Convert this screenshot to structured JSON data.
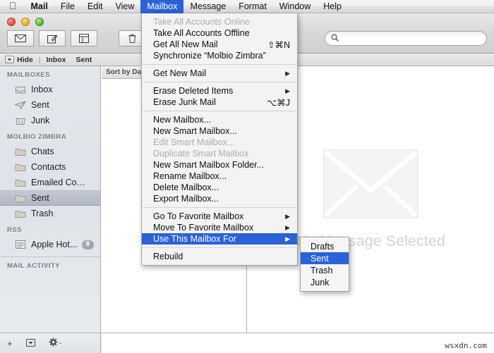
{
  "menubar": {
    "apple_icon": "apple-logo",
    "items": [
      {
        "label": "Mail",
        "bold": true,
        "active": false
      },
      {
        "label": "File",
        "bold": false,
        "active": false
      },
      {
        "label": "Edit",
        "bold": false,
        "active": false
      },
      {
        "label": "View",
        "bold": false,
        "active": false
      },
      {
        "label": "Mailbox",
        "bold": false,
        "active": true
      },
      {
        "label": "Message",
        "bold": false,
        "active": false
      },
      {
        "label": "Format",
        "bold": false,
        "active": false
      },
      {
        "label": "Window",
        "bold": false,
        "active": false
      },
      {
        "label": "Help",
        "bold": false,
        "active": false
      }
    ]
  },
  "toolbar": {
    "buttons": [
      {
        "name": "get-mail-button",
        "icon": "envelope-icon"
      },
      {
        "name": "compose-button",
        "icon": "compose-pencil-icon"
      },
      {
        "name": "reading-pane-button",
        "icon": "window-pane-icon"
      },
      {
        "name": "delete-button",
        "icon": "trash-icon"
      }
    ],
    "search_placeholder": "",
    "search_value": "",
    "search_icon": "search-icon"
  },
  "favbar": {
    "hide_label": "Hide",
    "hide_icon": "triangle-down-icon",
    "separator": "|",
    "items": [
      "Inbox",
      "Sent"
    ]
  },
  "sidebar": {
    "sections": [
      {
        "header": "MAILBOXES",
        "rows": [
          {
            "label": "Inbox",
            "icon": "inbox-tray-icon",
            "selected": false,
            "badge": ""
          },
          {
            "label": "Sent",
            "icon": "paper-plane-icon",
            "selected": false,
            "badge": ""
          },
          {
            "label": "Junk",
            "icon": "junk-bin-icon",
            "selected": false,
            "badge": ""
          }
        ]
      },
      {
        "header": "MOLBIO ZIMBRA",
        "rows": [
          {
            "label": "Chats",
            "icon": "folder-icon",
            "selected": false,
            "badge": ""
          },
          {
            "label": "Contacts",
            "icon": "folder-icon",
            "selected": false,
            "badge": ""
          },
          {
            "label": "Emailed Contacts",
            "icon": "folder-icon",
            "selected": false,
            "badge": ""
          },
          {
            "label": "Sent",
            "icon": "folder-icon",
            "selected": true,
            "badge": ""
          },
          {
            "label": "Trash",
            "icon": "folder-icon",
            "selected": false,
            "badge": ""
          }
        ]
      },
      {
        "header": "RSS",
        "rows": [
          {
            "label": "Apple Hot...",
            "icon": "rss-feed-icon",
            "selected": false,
            "badge": "8"
          }
        ]
      },
      {
        "header": "MAIL ACTIVITY",
        "rows": []
      }
    ]
  },
  "messagelist": {
    "sort_label": "Sort by Da"
  },
  "messageview": {
    "empty_icon": "large-envelope-icon",
    "empty_text": "No Message Selected"
  },
  "bottombar": {
    "add_label": "+",
    "actions_icon": "triangle-down-box-icon",
    "gear_icon": "gear-icon",
    "gear_caret": "-"
  },
  "watermark": {
    "text": "wsxdn.com"
  },
  "mailbox_menu": {
    "groups": [
      {
        "items": [
          {
            "label": "Take All Accounts Online",
            "disabled": true,
            "shortcut": "",
            "submenu": false,
            "highlighted": false
          },
          {
            "label": "Take All Accounts Offline",
            "disabled": false,
            "shortcut": "",
            "submenu": false,
            "highlighted": false
          },
          {
            "label": "Get All New Mail",
            "disabled": false,
            "shortcut": "⇧⌘N",
            "submenu": false,
            "highlighted": false
          },
          {
            "label": "Synchronize “Molbio Zimbra”",
            "disabled": false,
            "shortcut": "",
            "submenu": false,
            "highlighted": false
          }
        ]
      },
      {
        "items": [
          {
            "label": "Get New Mail",
            "disabled": false,
            "shortcut": "",
            "submenu": true,
            "highlighted": false
          }
        ]
      },
      {
        "items": [
          {
            "label": "Erase Deleted Items",
            "disabled": false,
            "shortcut": "",
            "submenu": true,
            "highlighted": false
          },
          {
            "label": "Erase Junk Mail",
            "disabled": false,
            "shortcut": "⌥⌘J",
            "submenu": false,
            "highlighted": false
          }
        ]
      },
      {
        "items": [
          {
            "label": "New Mailbox...",
            "disabled": false,
            "shortcut": "",
            "submenu": false,
            "highlighted": false
          },
          {
            "label": "New Smart Mailbox...",
            "disabled": false,
            "shortcut": "",
            "submenu": false,
            "highlighted": false
          },
          {
            "label": "Edit Smart Mailbox...",
            "disabled": true,
            "shortcut": "",
            "submenu": false,
            "highlighted": false
          },
          {
            "label": "Duplicate Smart Mailbox",
            "disabled": true,
            "shortcut": "",
            "submenu": false,
            "highlighted": false
          },
          {
            "label": "New Smart Mailbox Folder...",
            "disabled": false,
            "shortcut": "",
            "submenu": false,
            "highlighted": false
          },
          {
            "label": "Rename Mailbox...",
            "disabled": false,
            "shortcut": "",
            "submenu": false,
            "highlighted": false
          },
          {
            "label": "Delete Mailbox...",
            "disabled": false,
            "shortcut": "",
            "submenu": false,
            "highlighted": false
          },
          {
            "label": "Export Mailbox...",
            "disabled": false,
            "shortcut": "",
            "submenu": false,
            "highlighted": false
          }
        ]
      },
      {
        "items": [
          {
            "label": "Go To Favorite Mailbox",
            "disabled": false,
            "shortcut": "",
            "submenu": true,
            "highlighted": false
          },
          {
            "label": "Move To Favorite Mailbox",
            "disabled": false,
            "shortcut": "",
            "submenu": true,
            "highlighted": false
          },
          {
            "label": "Use This Mailbox For",
            "disabled": false,
            "shortcut": "",
            "submenu": true,
            "highlighted": true
          }
        ]
      },
      {
        "items": [
          {
            "label": "Rebuild",
            "disabled": false,
            "shortcut": "",
            "submenu": false,
            "highlighted": false
          }
        ]
      }
    ]
  },
  "use_submenu": {
    "items": [
      {
        "label": "Drafts",
        "highlighted": false
      },
      {
        "label": "Sent",
        "highlighted": true
      },
      {
        "label": "Trash",
        "highlighted": false
      },
      {
        "label": "Junk",
        "highlighted": false
      }
    ]
  },
  "colors": {
    "menu_highlight": "#2a62d8",
    "menubar_active": "#2a62d8",
    "sidebar_selected": "#b8bec9",
    "badge": "#9fa7b1",
    "empty_text": "#d2d2d2"
  }
}
